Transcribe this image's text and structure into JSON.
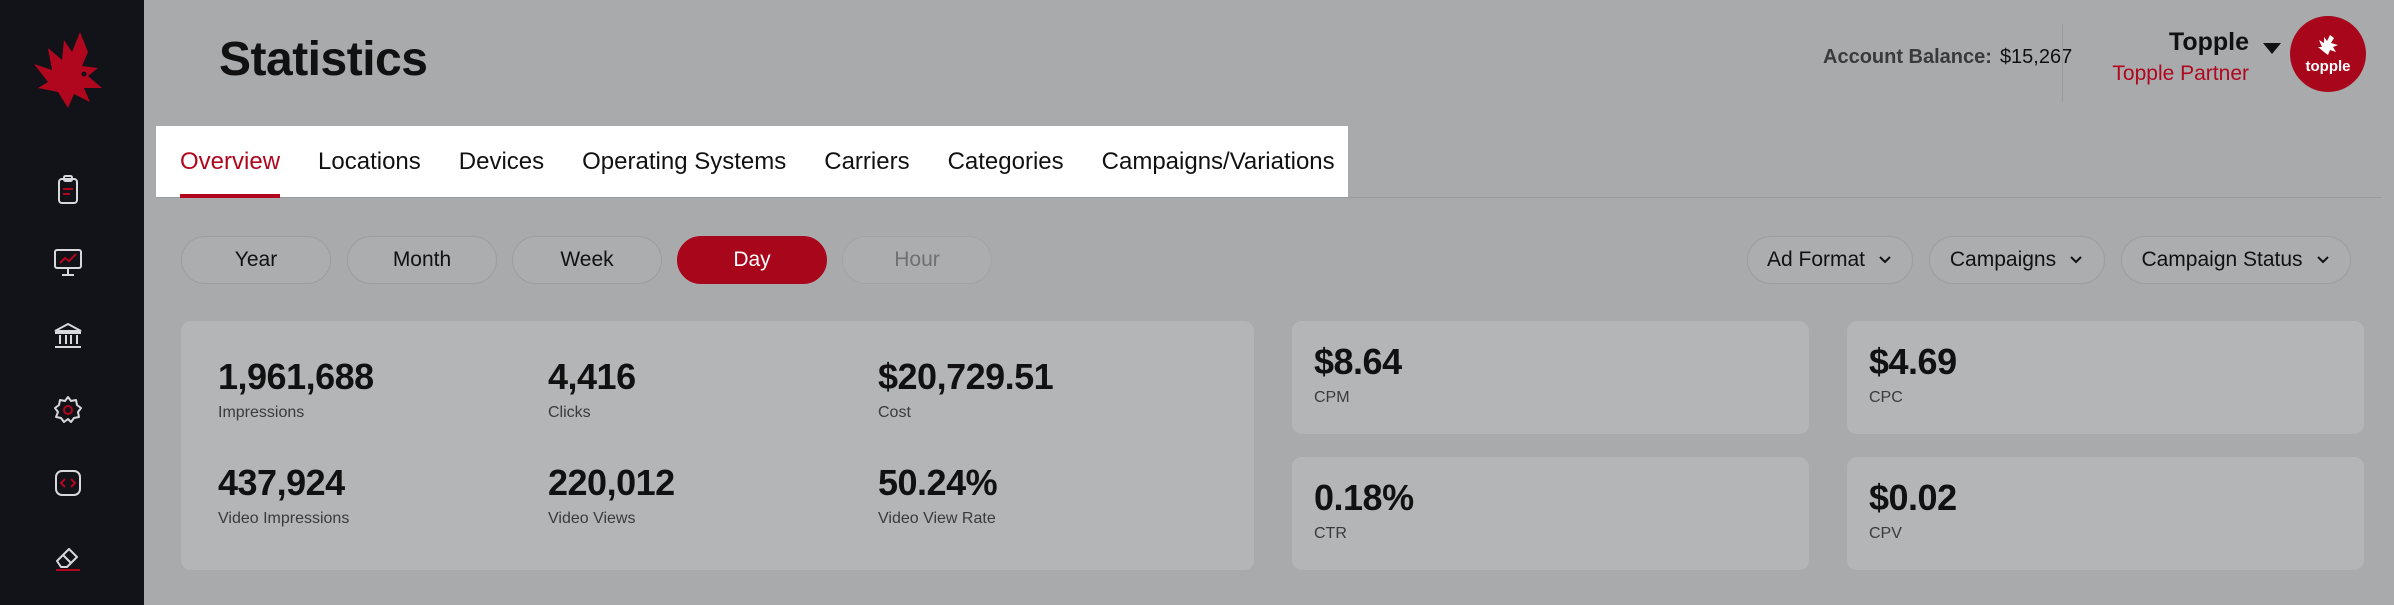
{
  "header": {
    "title": "Statistics",
    "account_balance_label": "Account Balance:",
    "account_balance_value": "$15,267",
    "user_name": "Topple",
    "user_role": "Topple Partner",
    "avatar_text": "topple"
  },
  "tabs": [
    {
      "label": "Overview",
      "active": true
    },
    {
      "label": "Locations"
    },
    {
      "label": "Devices"
    },
    {
      "label": "Operating Systems"
    },
    {
      "label": "Carriers"
    },
    {
      "label": "Categories"
    },
    {
      "label": "Campaigns/Variations"
    }
  ],
  "periods": {
    "year": "Year",
    "month": "Month",
    "week": "Week",
    "day": "Day",
    "hour": "Hour",
    "selected": "Day"
  },
  "filters": {
    "ad_format": "Ad Format",
    "campaigns": "Campaigns",
    "campaign_status": "Campaign Status"
  },
  "summary": {
    "impressions": {
      "value": "1,961,688",
      "label": "Impressions"
    },
    "clicks": {
      "value": "4,416",
      "label": "Clicks"
    },
    "cost": {
      "value": "$20,729.51",
      "label": "Cost"
    },
    "video_impressions": {
      "value": "437,924",
      "label": "Video Impressions"
    },
    "video_views": {
      "value": "220,012",
      "label": "Video Views"
    },
    "video_view_rate": {
      "value": "50.24%",
      "label": "Video View Rate"
    }
  },
  "kpis": {
    "cpm": {
      "value": "$8.64",
      "label": "CPM"
    },
    "cpc": {
      "value": "$4.69",
      "label": "CPC"
    },
    "ctr": {
      "value": "0.18%",
      "label": "CTR"
    },
    "cpv": {
      "value": "$0.02",
      "label": "CPV"
    }
  },
  "colors": {
    "brand_red": "#a8061b",
    "sidebar_bg": "#121219",
    "page_bg": "#a9aaac"
  },
  "icons": {
    "logo": "eagle-logo",
    "nav": [
      "clipboard-icon",
      "presentation-icon",
      "bank-icon",
      "gear-icon",
      "code-icon",
      "eraser-icon"
    ]
  }
}
